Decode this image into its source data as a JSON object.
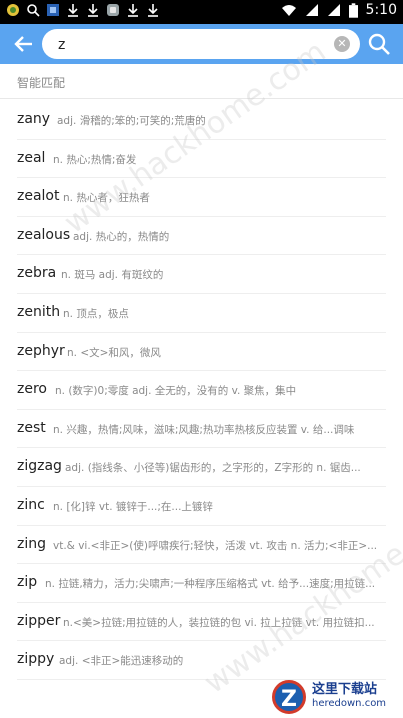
{
  "status_bar": {
    "time": "5:10"
  },
  "search": {
    "value": "z"
  },
  "section": {
    "title": "智能匹配"
  },
  "results": [
    {
      "word": "zany",
      "definition": "adj. 滑稽的;笨的;可笑的;荒唐的"
    },
    {
      "word": "zeal",
      "definition": "n. 热心;热情;奋发"
    },
    {
      "word": "zealot",
      "definition": "n. 热心者，狂热者"
    },
    {
      "word": "zealous",
      "definition": "adj. 热心的，热情的"
    },
    {
      "word": "zebra",
      "definition": "n. 斑马 adj. 有斑纹的"
    },
    {
      "word": "zenith",
      "definition": "n. 顶点，极点"
    },
    {
      "word": "zephyr",
      "definition": "n. <文>和风，微风"
    },
    {
      "word": "zero",
      "definition": "n. (数字)0;零度 adj. 全无的，没有的 v.  聚焦，集中"
    },
    {
      "word": "zest",
      "definition": "n. 兴趣，热情;风味，滋味;风趣;热功率热核反应装置 v. 给...调味"
    },
    {
      "word": "zigzag",
      "definition": "adj. (指线条、小径等)锯齿形的，之字形的，Z字形的 n. 锯齿..."
    },
    {
      "word": "zinc",
      "definition": "n. [化]锌 vt. 镀锌于...;在...上镀锌"
    },
    {
      "word": "zing",
      "definition": "vt.& vi.<非正>(使)呼啸疾行;轻快，活泼 vt. 攻击 n.  活力;<非正>..."
    },
    {
      "word": "zip",
      "definition": "n. 拉链,精力，活力;尖啸声;一种程序压缩格式 vt.  给予...速度;用拉链..."
    },
    {
      "word": "zipper",
      "definition": "n.<美>拉链;用拉链的人，装拉链的包 vi.  拉上拉链 vt.  用拉链扣..."
    },
    {
      "word": "zippy",
      "definition": "adj. <非正>能迅速移动的"
    }
  ],
  "watermark": {
    "top": "www.hackhome.com",
    "bottom": "www.hackhome.com"
  },
  "logo": {
    "letter": "Z",
    "cn": "这里下载站",
    "en": "heredown.com"
  },
  "colors": {
    "toolbar": "#5aa4f0",
    "status_bar": "#000000"
  }
}
